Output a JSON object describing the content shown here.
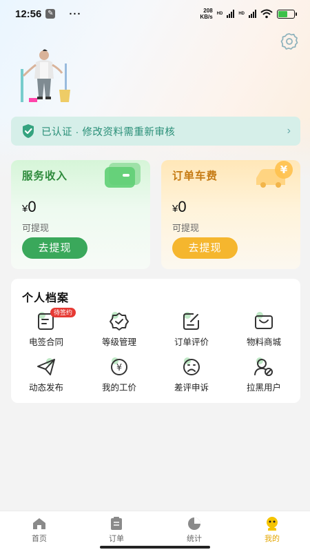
{
  "status": {
    "time": "12:56",
    "more": "···",
    "net_speed_top": "208",
    "net_speed_bottom": "KB/s",
    "hd1": "HD",
    "hd2": "HD"
  },
  "certification": {
    "text": "已认证 · 修改资料需重新审核"
  },
  "income_cards": [
    {
      "title": "服务收入",
      "currency": "¥",
      "amount": "0",
      "sub": "可提现",
      "button": "去提现",
      "color": "#3aa85b"
    },
    {
      "title": "订单车费",
      "currency": "¥",
      "amount": "0",
      "sub": "可提现",
      "button": "去提现",
      "color": "#f5b62e"
    }
  ],
  "profile": {
    "title": "个人档案",
    "items": [
      {
        "label": "电签合同",
        "icon": "contract-icon",
        "badge": "待签约"
      },
      {
        "label": "等级管理",
        "icon": "level-badge-icon"
      },
      {
        "label": "订单评价",
        "icon": "edit-review-icon"
      },
      {
        "label": "物料商城",
        "icon": "shop-bag-icon"
      },
      {
        "label": "动态发布",
        "icon": "send-icon"
      },
      {
        "label": "我的工价",
        "icon": "yen-coin-icon"
      },
      {
        "label": "差评申诉",
        "icon": "sad-face-icon"
      },
      {
        "label": "拉黑用户",
        "icon": "block-user-icon"
      }
    ]
  },
  "tabs": [
    {
      "label": "首页",
      "icon": "home-icon"
    },
    {
      "label": "订单",
      "icon": "order-icon"
    },
    {
      "label": "统计",
      "icon": "stats-icon"
    },
    {
      "label": "我的",
      "icon": "my-icon",
      "active": true
    }
  ],
  "colors": {
    "accent_green": "#3aa85b",
    "accent_orange": "#f5b62e",
    "cert_text": "#2a8f78",
    "badge_red": "#e63a34",
    "tab_active": "#e3a600"
  }
}
